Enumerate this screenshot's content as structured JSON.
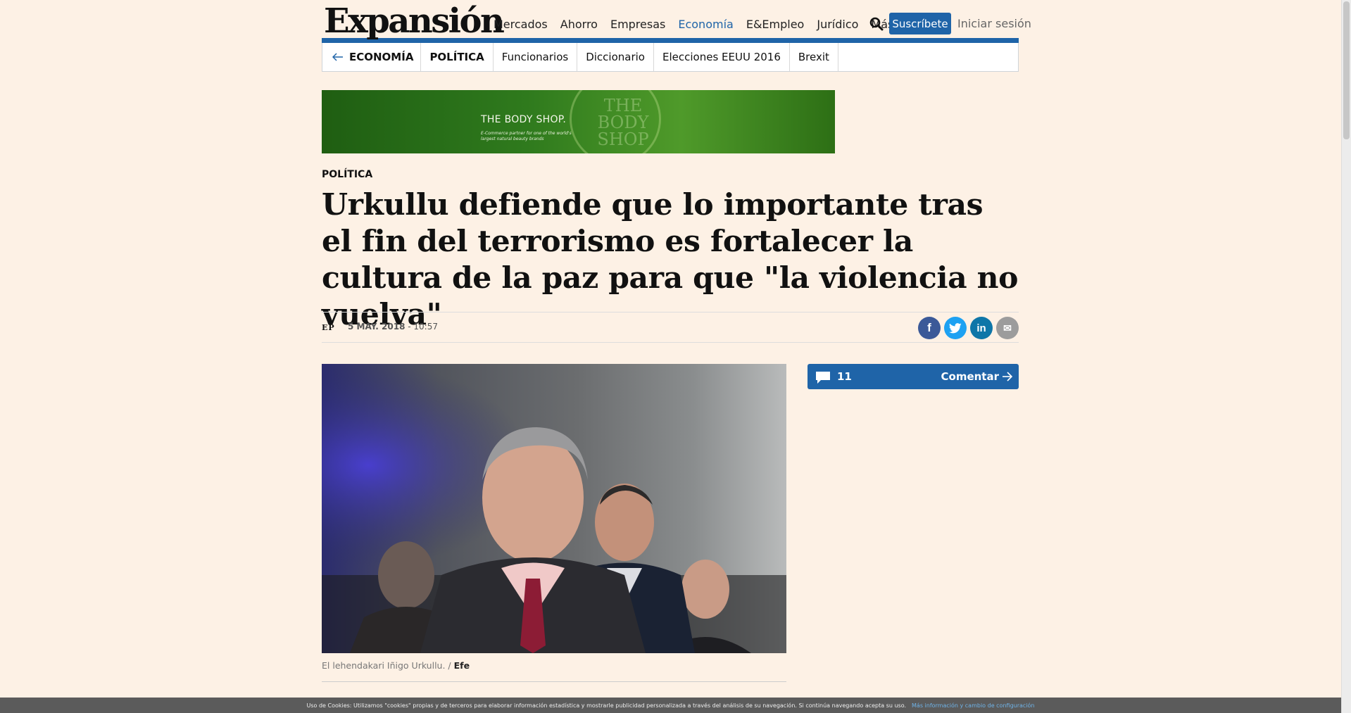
{
  "header": {
    "logo": "Expansión",
    "nav": [
      {
        "label": "Mercados",
        "active": false
      },
      {
        "label": "Ahorro",
        "active": false
      },
      {
        "label": "Empresas",
        "active": false
      },
      {
        "label": "Economía",
        "active": true
      },
      {
        "label": "E&Empleo",
        "active": false
      },
      {
        "label": "Jurídico",
        "active": false
      },
      {
        "label": "Más",
        "active": false
      }
    ],
    "subscribe_label": "Suscríbete",
    "login_label": "Iniciar sesión",
    "accent_color": "#1f64a8"
  },
  "subnav": {
    "back_label": "ECONOMÍA",
    "current": "POLÍTICA",
    "items": [
      "Funcionarios",
      "Diccionario",
      "Elecciones EEUU 2016",
      "Brexit"
    ]
  },
  "ad": {
    "brand": "THE BODY SHOP.",
    "tagline": "E-Commerce partner for one of the world's largest natural beauty brands",
    "ghost": "THE BODY SHOP"
  },
  "article": {
    "section": "POLÍTICA",
    "title": "Urkullu defiende que lo importante tras el fin del terrorismo es fortalecer la cultura de la paz para que \"la violencia no vuelva\"",
    "author": "EP",
    "date": "5 MAY. 2018",
    "time": " - 10:57",
    "caption": "El lehendakari Iñigo Urkullu.",
    "caption_sep": " / ",
    "credit": "Efe"
  },
  "share": [
    {
      "name": "facebook",
      "glyph": "f",
      "color": "#3b5998"
    },
    {
      "name": "twitter",
      "glyph": "t",
      "color": "#1da1f2"
    },
    {
      "name": "linkedin",
      "glyph": "in",
      "color": "#0e76a8"
    },
    {
      "name": "email",
      "glyph": "✉",
      "color": "#9c9c9c"
    }
  ],
  "comments": {
    "count": "11",
    "label": "Comentar"
  },
  "cookie": {
    "text": "Uso de Cookies: Utilizamos \"cookies\" propias y de terceros para elaborar información estadística y mostrarle publicidad personalizada a través del análisis de su navegación. Si continúa navegando acepta su uso.",
    "link": "Más información y cambio de configuración"
  }
}
